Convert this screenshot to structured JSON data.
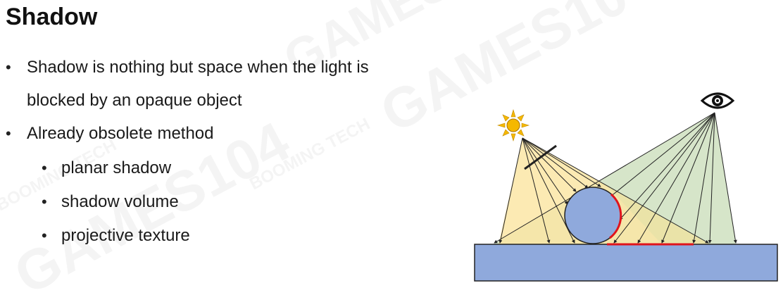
{
  "slide": {
    "title": "Shadow",
    "bullets": [
      {
        "text": "Shadow is nothing but space when the light is"
      },
      {
        "text": "blocked by an opaque object"
      },
      {
        "text": "Already obsolete method"
      }
    ],
    "sub_bullets": [
      {
        "text": "planar shadow"
      },
      {
        "text": "shadow volume"
      },
      {
        "text": "projective texture"
      }
    ],
    "bullet_glyph": "•"
  },
  "figure": {
    "light_icon": "sun-icon",
    "viewer_icon": "eye-icon",
    "colors": {
      "ground": "#8fa9dc",
      "sphere": "#8fa9dc",
      "light_rays": "#fbe6a6",
      "view_rays": "#cfe0bf",
      "shadow": "#e0141b",
      "sun": "#f5b800"
    }
  },
  "watermark": {
    "text_a": "GAMES104",
    "text_b": "BOOMING TECH"
  }
}
